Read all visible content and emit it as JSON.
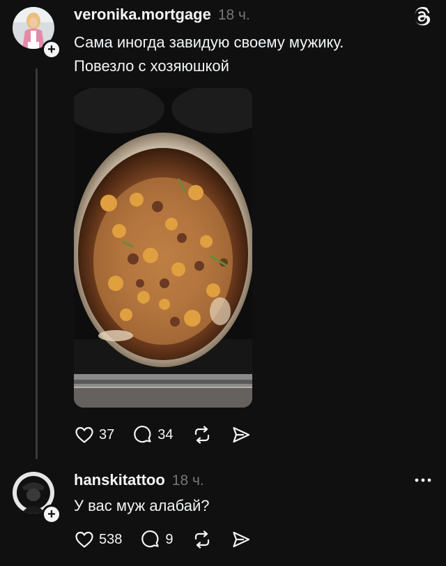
{
  "posts": [
    {
      "username": "veronika.mortgage",
      "time": "18 ч.",
      "text_line1": "Сама иногда завидую своему мужику.",
      "text_line2": "Повезло с хозяюшкой",
      "likes": "37",
      "comments": "34",
      "has_image": true,
      "image_description": "food-in-cast-iron-pot"
    },
    {
      "username": "hanskitattoo",
      "time": "18 ч.",
      "text": "У вас муж алабай?",
      "likes": "538",
      "comments": "9"
    }
  ],
  "icons": {
    "app_logo": "threads-logo-icon",
    "like": "heart-icon",
    "comment": "comment-bubble-icon",
    "repost": "repost-icon",
    "share": "send-icon",
    "more": "more-dots-icon",
    "follow": "plus-icon"
  },
  "colors": {
    "background": "#101010",
    "text": "#f3f5f7",
    "secondary_text": "#777777",
    "thread_line": "#3b3b3b"
  }
}
